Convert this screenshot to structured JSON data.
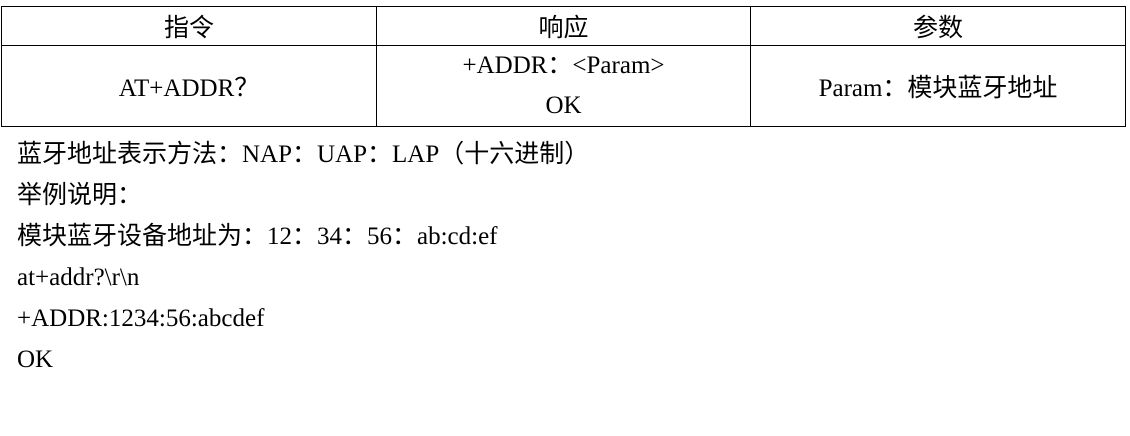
{
  "table": {
    "headers": [
      "指令",
      "响应",
      "参数"
    ],
    "row": {
      "command": "AT+ADDR？",
      "response_line1": "+ADDR：<Param>",
      "response_line2": "OK",
      "param": "Param：模块蓝牙地址"
    }
  },
  "notes": [
    "蓝牙地址表示方法：NAP：UAP：LAP（十六进制）",
    "举例说明：",
    "模块蓝牙设备地址为：12：34：56：ab:cd:ef",
    "at+addr?\\r\\n",
    "+ADDR:1234:56:abcdef",
    "OK"
  ]
}
